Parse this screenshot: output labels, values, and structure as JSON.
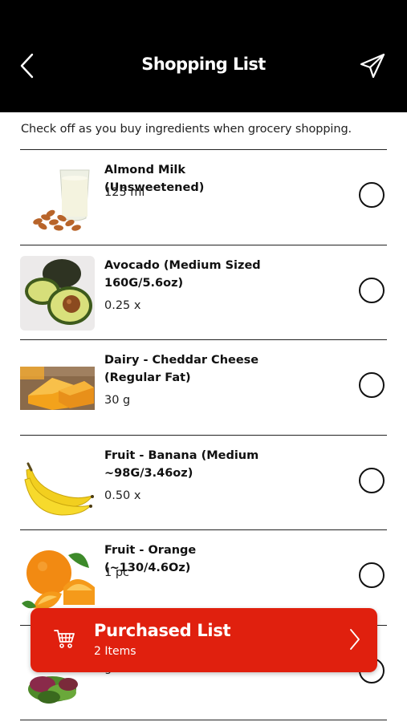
{
  "header": {
    "title": "Shopping List",
    "back_icon": "chevron-left-icon",
    "send_icon": "paper-plane-icon"
  },
  "instructions": "Check off as you buy ingredients when grocery shopping.",
  "items": [
    {
      "name": "Almond Milk (Unsweetened)",
      "quantity": "125 ml",
      "image": "almond-milk-image",
      "checked": false
    },
    {
      "name": "Avocado (Medium Sized 160G/5.6oz)",
      "quantity": "0.25 x",
      "image": "avocado-image",
      "checked": false
    },
    {
      "name": "Dairy - Cheddar Cheese (Regular Fat)",
      "quantity": "30 g",
      "image": "cheddar-cheese-image",
      "checked": false
    },
    {
      "name": "Fruit - Banana (Medium ~98G/3.46oz)",
      "quantity": "0.50 x",
      "image": "banana-image",
      "checked": false
    },
    {
      "name": "Fruit - Orange (~130/4.6Oz)",
      "quantity": "1 pc",
      "image": "orange-image",
      "checked": false
    },
    {
      "name": "",
      "quantity": "g",
      "image": "salad-greens-image",
      "checked": false
    }
  ],
  "purchased_list": {
    "title": "Purchased List",
    "count": "2 Items",
    "icon": "shopping-cart-icon",
    "accent": "#e0200e"
  },
  "colors": {
    "header_bg": "#000000",
    "accent": "#e0200e"
  }
}
